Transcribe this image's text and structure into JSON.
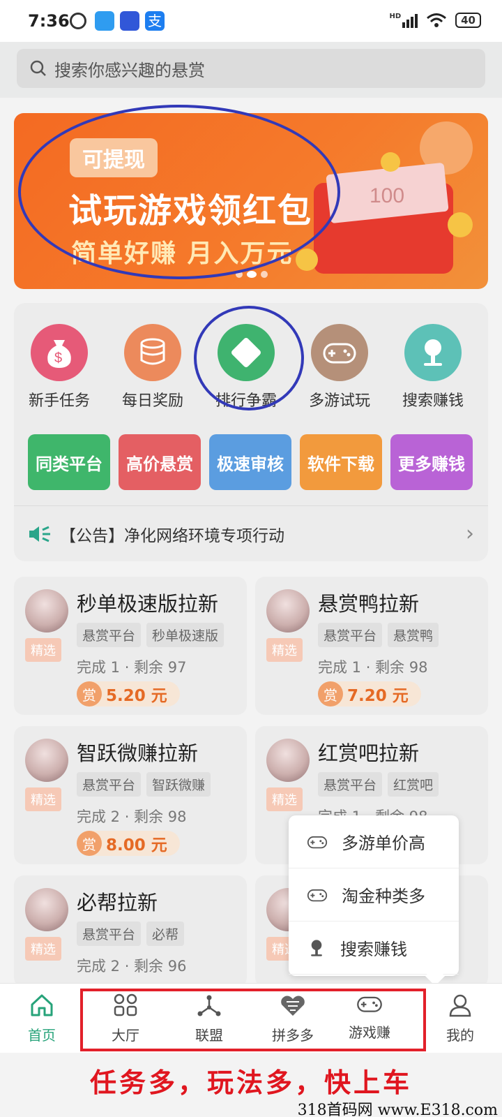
{
  "status_bar": {
    "time": "7:36",
    "battery": "40",
    "network": "HD"
  },
  "search": {
    "placeholder": "搜索你感兴趣的悬赏"
  },
  "banner": {
    "pill": "可提现",
    "title": "试玩游戏领红包",
    "subtitle": "简单好赚 月入万元",
    "price_tag": "100"
  },
  "quick_menu": [
    {
      "label": "新手任务",
      "icon": "money-bag-icon",
      "color": "#e65a78"
    },
    {
      "label": "每日奖励",
      "icon": "coin-stack-icon",
      "color": "#ec8a5c"
    },
    {
      "label": "排行争霸",
      "icon": "diamond-icon",
      "color": "#3fb36f"
    },
    {
      "label": "多游试玩",
      "icon": "gamepad-icon",
      "color": "#b59079"
    },
    {
      "label": "搜索赚钱",
      "icon": "search-money-icon",
      "color": "#5dc1b7"
    }
  ],
  "tiles": [
    {
      "label": "同类平台",
      "color": "#3fb66b"
    },
    {
      "label": "高价悬赏",
      "color": "#e45f63"
    },
    {
      "label": "极速审核",
      "color": "#5b9de0"
    },
    {
      "label": "软件下载",
      "color": "#f29a3d"
    },
    {
      "label": "更多赚钱",
      "color": "#b963d6"
    }
  ],
  "notice": {
    "text": "【公告】净化网络环境专项行动"
  },
  "tasks": [
    {
      "title": "秒单极速版拉新",
      "badge": "精选",
      "tags": [
        "悬赏平台",
        "秒单极速版"
      ],
      "status": "完成 1 · 剩余 97",
      "reward_icon": "赏",
      "reward": "5.20 元"
    },
    {
      "title": "悬赏鸭拉新",
      "badge": "精选",
      "tags": [
        "悬赏平台",
        "悬赏鸭"
      ],
      "status": "完成 1 · 剩余 98",
      "reward_icon": "赏",
      "reward": "7.20 元"
    },
    {
      "title": "智跃微赚拉新",
      "badge": "精选",
      "tags": [
        "悬赏平台",
        "智跃微赚"
      ],
      "status": "完成 2 · 剩余 98",
      "reward_icon": "赏",
      "reward": "8.00 元"
    },
    {
      "title": "红赏吧拉新",
      "badge": "精选",
      "tags": [
        "悬赏平台",
        "红赏吧"
      ],
      "status": "完成 1 · 剩余 98",
      "reward_icon": "",
      "reward": ""
    },
    {
      "title": "必帮拉新",
      "badge": "精选",
      "tags": [
        "悬赏平台",
        "必帮"
      ],
      "status": "完成 2 · 剩余 96",
      "reward_icon": "",
      "reward": ""
    },
    {
      "title": "",
      "badge": "精选",
      "tags": [],
      "status": "",
      "reward_icon": "",
      "reward": ""
    }
  ],
  "popup": [
    {
      "label": "多游单价高",
      "icon": "gamepad-icon"
    },
    {
      "label": "淘金种类多",
      "icon": "gamepad-icon"
    },
    {
      "label": "搜索赚钱",
      "icon": "search-money-icon"
    }
  ],
  "tabbar": [
    {
      "label": "首页",
      "icon": "home-icon",
      "active": true
    },
    {
      "label": "大厅",
      "icon": "grid-icon",
      "active": false
    },
    {
      "label": "联盟",
      "icon": "network-icon",
      "active": false
    },
    {
      "label": "拼多多",
      "icon": "pinduoduo-icon",
      "active": false
    },
    {
      "label": "游戏赚",
      "icon": "gamepad-icon",
      "active": false
    },
    {
      "label": "我的",
      "icon": "user-icon",
      "active": false
    }
  ],
  "slogan": "任务多，玩法多，快上车",
  "watermark": "318首码网 www.E318.com"
}
